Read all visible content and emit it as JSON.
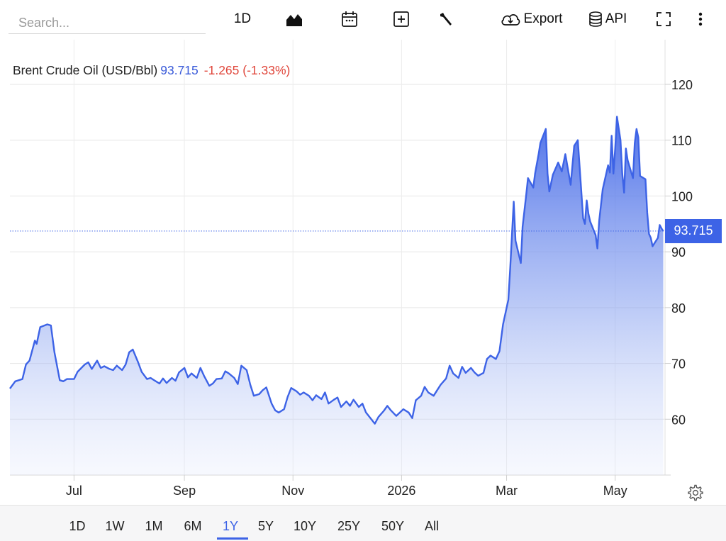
{
  "toolbar": {
    "search_placeholder": "Search...",
    "interval_label": "1D",
    "export_label": "Export",
    "api_label": "API"
  },
  "quote": {
    "name": "Brent Crude Oil (USD/Bbl)",
    "price": "93.715",
    "change": "-1.265 (-1.33%)"
  },
  "last_label": "93.715",
  "ranges": [
    "1D",
    "1W",
    "1M",
    "6M",
    "1Y",
    "5Y",
    "10Y",
    "25Y",
    "50Y",
    "All"
  ],
  "active_range": "1Y",
  "colors": {
    "line": "#3d63e6",
    "down": "#e0473c"
  },
  "chart_data": {
    "type": "area",
    "title": "",
    "xlabel": "",
    "ylabel": "",
    "ylim": [
      50,
      128
    ],
    "xlim": [
      "2025-05-26",
      "2026-05-29"
    ],
    "y_ticks": [
      60,
      70,
      80,
      90,
      100,
      110,
      120
    ],
    "x_ticks": [
      {
        "label": "Jul",
        "date": "2025-07-01"
      },
      {
        "label": "Sep",
        "date": "2025-09-01"
      },
      {
        "label": "Nov",
        "date": "2025-11-01"
      },
      {
        "label": "2026",
        "date": "2026-01-01"
      },
      {
        "label": "Mar",
        "date": "2026-03-01"
      },
      {
        "label": "May",
        "date": "2026-05-01"
      }
    ],
    "last_value": 93.715,
    "grid": true,
    "series": [
      {
        "name": "Brent Crude Oil (USD/Bbl)",
        "points": [
          [
            "2025-05-26",
            65.5
          ],
          [
            "2025-05-29",
            66.8
          ],
          [
            "2025-06-02",
            67.2
          ],
          [
            "2025-06-04",
            69.8
          ],
          [
            "2025-06-06",
            70.5
          ],
          [
            "2025-06-09",
            74.1
          ],
          [
            "2025-06-10",
            73.5
          ],
          [
            "2025-06-12",
            76.5
          ],
          [
            "2025-06-16",
            77
          ],
          [
            "2025-06-18",
            76.8
          ],
          [
            "2025-06-20",
            72
          ],
          [
            "2025-06-23",
            67
          ],
          [
            "2025-06-25",
            66.8
          ],
          [
            "2025-06-27",
            67.2
          ],
          [
            "2025-07-01",
            67.2
          ],
          [
            "2025-07-03",
            68.5
          ],
          [
            "2025-07-07",
            69.8
          ],
          [
            "2025-07-09",
            70.2
          ],
          [
            "2025-07-11",
            69
          ],
          [
            "2025-07-14",
            70.5
          ],
          [
            "2025-07-16",
            69.2
          ],
          [
            "2025-07-18",
            69.5
          ],
          [
            "2025-07-21",
            69
          ],
          [
            "2025-07-23",
            68.8
          ],
          [
            "2025-07-25",
            69.6
          ],
          [
            "2025-07-28",
            68.8
          ],
          [
            "2025-07-30",
            69.8
          ],
          [
            "2025-08-01",
            72
          ],
          [
            "2025-08-03",
            72.5
          ],
          [
            "2025-08-06",
            70.2
          ],
          [
            "2025-08-08",
            68.5
          ],
          [
            "2025-08-11",
            67.2
          ],
          [
            "2025-08-13",
            67.4
          ],
          [
            "2025-08-15",
            67
          ],
          [
            "2025-08-18",
            66.4
          ],
          [
            "2025-08-20",
            67.3
          ],
          [
            "2025-08-22",
            66.5
          ],
          [
            "2025-08-25",
            67.4
          ],
          [
            "2025-08-27",
            66.9
          ],
          [
            "2025-08-29",
            68.4
          ],
          [
            "2025-09-01",
            69.2
          ],
          [
            "2025-09-03",
            67.5
          ],
          [
            "2025-09-05",
            68.2
          ],
          [
            "2025-09-08",
            67.4
          ],
          [
            "2025-09-10",
            69.2
          ],
          [
            "2025-09-12",
            67.8
          ],
          [
            "2025-09-15",
            66
          ],
          [
            "2025-09-17",
            66.4
          ],
          [
            "2025-09-19",
            67.2
          ],
          [
            "2025-09-22",
            67.3
          ],
          [
            "2025-09-24",
            68.6
          ],
          [
            "2025-09-26",
            68.2
          ],
          [
            "2025-09-29",
            67.4
          ],
          [
            "2025-10-01",
            66.3
          ],
          [
            "2025-10-03",
            69.6
          ],
          [
            "2025-10-06",
            68.8
          ],
          [
            "2025-10-08",
            66.2
          ],
          [
            "2025-10-10",
            64.2
          ],
          [
            "2025-10-13",
            64.5
          ],
          [
            "2025-10-15",
            65.2
          ],
          [
            "2025-10-17",
            65.7
          ],
          [
            "2025-10-20",
            62.8
          ],
          [
            "2025-10-22",
            61.6
          ],
          [
            "2025-10-24",
            61.2
          ],
          [
            "2025-10-27",
            61.8
          ],
          [
            "2025-10-29",
            64
          ],
          [
            "2025-10-31",
            65.6
          ],
          [
            "2025-11-03",
            65
          ],
          [
            "2025-11-05",
            64.4
          ],
          [
            "2025-11-07",
            64.8
          ],
          [
            "2025-11-10",
            64.2
          ],
          [
            "2025-11-12",
            63.4
          ],
          [
            "2025-11-14",
            64.3
          ],
          [
            "2025-11-17",
            63.6
          ],
          [
            "2025-11-19",
            64.8
          ],
          [
            "2025-11-21",
            62.8
          ],
          [
            "2025-11-24",
            63.5
          ],
          [
            "2025-11-26",
            63.9
          ],
          [
            "2025-11-28",
            62.2
          ],
          [
            "2025-12-01",
            63.2
          ],
          [
            "2025-12-03",
            62.4
          ],
          [
            "2025-12-05",
            63.5
          ],
          [
            "2025-12-08",
            62.2
          ],
          [
            "2025-12-10",
            62.8
          ],
          [
            "2025-12-12",
            61.2
          ],
          [
            "2025-12-15",
            60
          ],
          [
            "2025-12-17",
            59.2
          ],
          [
            "2025-12-19",
            60.4
          ],
          [
            "2025-12-22",
            61.5
          ],
          [
            "2025-12-24",
            62.4
          ],
          [
            "2025-12-26",
            61.6
          ],
          [
            "2025-12-29",
            60.6
          ],
          [
            "2026-01-02",
            61.8
          ],
          [
            "2026-01-05",
            61.2
          ],
          [
            "2026-01-07",
            60.2
          ],
          [
            "2026-01-09",
            63.4
          ],
          [
            "2026-01-12",
            64.2
          ],
          [
            "2026-01-14",
            65.8
          ],
          [
            "2026-01-16",
            64.8
          ],
          [
            "2026-01-19",
            64.2
          ],
          [
            "2026-01-21",
            65.2
          ],
          [
            "2026-01-23",
            66.2
          ],
          [
            "2026-01-26",
            67.3
          ],
          [
            "2026-01-28",
            69.6
          ],
          [
            "2026-01-30",
            68.2
          ],
          [
            "2026-02-02",
            67.4
          ],
          [
            "2026-02-04",
            69.4
          ],
          [
            "2026-02-06",
            68.3
          ],
          [
            "2026-02-09",
            69.2
          ],
          [
            "2026-02-11",
            68.4
          ],
          [
            "2026-02-13",
            67.8
          ],
          [
            "2026-02-16",
            68.3
          ],
          [
            "2026-02-18",
            70.8
          ],
          [
            "2026-02-20",
            71.4
          ],
          [
            "2026-02-23",
            70.8
          ],
          [
            "2026-02-25",
            72.2
          ],
          [
            "2026-02-27",
            77
          ],
          [
            "2026-03-02",
            81.4
          ],
          [
            "2026-03-03",
            87
          ],
          [
            "2026-03-04",
            93
          ],
          [
            "2026-03-05",
            99
          ],
          [
            "2026-03-06",
            92
          ],
          [
            "2026-03-09",
            88
          ],
          [
            "2026-03-10",
            94.5
          ],
          [
            "2026-03-12",
            100.2
          ],
          [
            "2026-03-13",
            103.2
          ],
          [
            "2026-03-16",
            101.5
          ],
          [
            "2026-03-17",
            104
          ],
          [
            "2026-03-19",
            107.5
          ],
          [
            "2026-03-20",
            109.5
          ],
          [
            "2026-03-23",
            112
          ],
          [
            "2026-03-24",
            104
          ],
          [
            "2026-03-25",
            100.8
          ],
          [
            "2026-03-27",
            103.8
          ],
          [
            "2026-03-30",
            106
          ],
          [
            "2026-04-01",
            104.4
          ],
          [
            "2026-04-03",
            107.5
          ],
          [
            "2026-04-06",
            102
          ],
          [
            "2026-04-08",
            109
          ],
          [
            "2026-04-10",
            110
          ],
          [
            "2026-04-13",
            96
          ],
          [
            "2026-04-14",
            95
          ],
          [
            "2026-04-15",
            99.2
          ],
          [
            "2026-04-16",
            96.8
          ],
          [
            "2026-04-17",
            95.4
          ],
          [
            "2026-04-20",
            93
          ],
          [
            "2026-04-21",
            90.6
          ],
          [
            "2026-04-22",
            95.5
          ],
          [
            "2026-04-24",
            101.2
          ],
          [
            "2026-04-27",
            105.5
          ],
          [
            "2026-04-28",
            104.2
          ],
          [
            "2026-04-29",
            110.8
          ],
          [
            "2026-04-30",
            104
          ],
          [
            "2026-05-01",
            108.5
          ],
          [
            "2026-05-02",
            114.2
          ],
          [
            "2026-05-04",
            110
          ],
          [
            "2026-05-05",
            104
          ],
          [
            "2026-05-06",
            100.6
          ],
          [
            "2026-05-07",
            108.5
          ],
          [
            "2026-05-08",
            106.4
          ],
          [
            "2026-05-11",
            103.2
          ],
          [
            "2026-05-12",
            109.5
          ],
          [
            "2026-05-13",
            112
          ],
          [
            "2026-05-14",
            110.5
          ],
          [
            "2026-05-15",
            103.6
          ],
          [
            "2026-05-18",
            103
          ],
          [
            "2026-05-19",
            97
          ],
          [
            "2026-05-20",
            93.2
          ],
          [
            "2026-05-21",
            92.5
          ],
          [
            "2026-05-22",
            91
          ],
          [
            "2026-05-25",
            92.5
          ],
          [
            "2026-05-26",
            94.8
          ],
          [
            "2026-05-27",
            94.2
          ],
          [
            "2026-05-28",
            93.7
          ]
        ]
      }
    ]
  }
}
